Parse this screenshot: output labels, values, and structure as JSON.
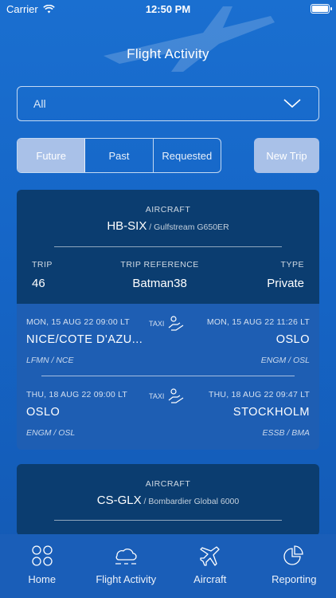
{
  "status_bar": {
    "carrier": "Carrier",
    "time": "12:50 PM"
  },
  "header": {
    "title": "Flight Activity"
  },
  "filter": {
    "value": "All"
  },
  "segments": [
    "Future",
    "Past",
    "Requested"
  ],
  "new_trip_label": "New Trip",
  "trips": [
    {
      "aircraft_label": "AIRCRAFT",
      "registration": "HB-SIX",
      "aircraft_type": " / Gulfstream G650ER",
      "trip_label": "TRIP",
      "trip_value": "46",
      "reference_label": "TRIP REFERENCE",
      "reference_value": "Batman38",
      "type_label": "TYPE",
      "type_value": "Private",
      "legs": [
        {
          "dep_time": "MON, 15 AUG 22 09:00 LT",
          "arr_time": "MON, 15 AUG 22 11:26 LT",
          "taxi": "TAXI",
          "from": "NICE/COTE D'AZU...",
          "to": "OSLO",
          "from_code": "LFMN / NCE",
          "to_code": "ENGM / OSL"
        },
        {
          "dep_time": "THU, 18 AUG 22 09:00 LT",
          "arr_time": "THU, 18 AUG 22 09:47 LT",
          "taxi": "TAXI",
          "from": "OSLO",
          "to": "STOCKHOLM",
          "from_code": "ENGM / OSL",
          "to_code": "ESSB / BMA"
        }
      ]
    },
    {
      "aircraft_label": "AIRCRAFT",
      "registration": "CS-GLX",
      "aircraft_type": " / Bombardier Global 6000"
    }
  ],
  "tabs": [
    {
      "label": "Home",
      "icon": "home-grid-icon"
    },
    {
      "label": "Flight Activity",
      "icon": "flight-activity-icon"
    },
    {
      "label": "Aircraft",
      "icon": "airplane-icon"
    },
    {
      "label": "Reporting",
      "icon": "pie-chart-icon"
    }
  ],
  "colors": {
    "background": "#1565c6",
    "card_header": "#0b3d70",
    "card_legs": "#1e5eb3",
    "segment_active": "#a9c1e8"
  }
}
